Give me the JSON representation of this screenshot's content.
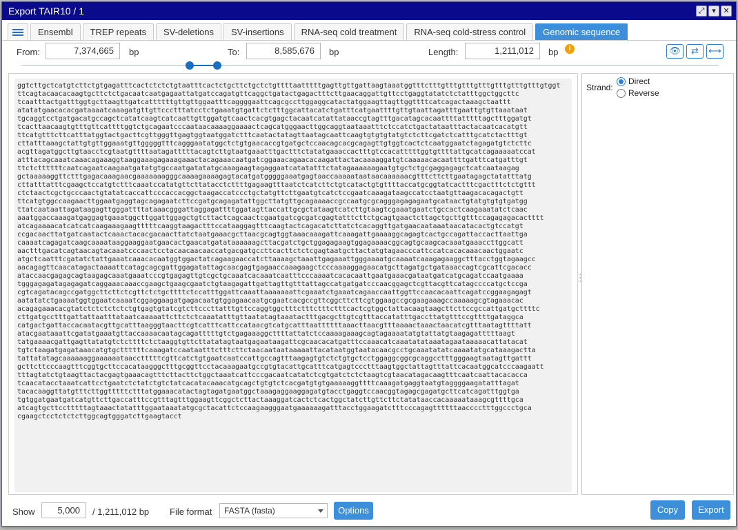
{
  "window": {
    "title": "Export TAIR10 / 1",
    "buttons": {
      "maximize": "⤢",
      "minimize": "▾",
      "close": "✕"
    }
  },
  "tabs": [
    {
      "label": "Ensembl"
    },
    {
      "label": "TREP repeats"
    },
    {
      "label": "SV-deletions"
    },
    {
      "label": "SV-insertions"
    },
    {
      "label": "RNA-seq cold treatment"
    },
    {
      "label": "RNA-seq cold-stress control"
    },
    {
      "label": "Genomic sequence",
      "active": true
    }
  ],
  "range": {
    "from_label": "From:",
    "from_value": "7,374,665",
    "from_unit": "bp",
    "to_label": "To:",
    "to_value": "8,585,676",
    "to_unit": "bp",
    "length_label": "Length:",
    "length_value": "1,211,012",
    "length_unit": "bp",
    "info_icon": "i"
  },
  "tools": {
    "view": "👁",
    "swap": "⇄",
    "fit": "⟷"
  },
  "strand": {
    "label": "Strand:",
    "options": [
      {
        "label": "Direct",
        "checked": true
      },
      {
        "label": "Reverse",
        "checked": false
      }
    ]
  },
  "sequence": {
    "lines": [
      "ggtcttgctcatgtcttctgtgagatttcactctctctgtaatttcactctgcttctgctctgttttaatttttgagttgttgattaagtaaatggtttctttgtttgtttgtttgtttgtttgtttgtggt",
      "ttcagtacaacacaagtgcttctctgacaatcaatgagaattatgatccagatgttcaggctgatactgagactttcttgaacaggattgttcctgaggtatatctctatttggctggcttc",
      "tcaatttactgatttggtgcttaagttgatcattttttgttgttggaatttcaggggaattcagcgccttggaggcatactatggaagttagttggttttcatcagactaaagctaattt",
      "atatatgaacacacgataaaatcaaagatgttgttccctttatcctctgaaatgtgattctctttggcattacatctgatttcatgaattttgttgtaattagatttgaattgtgttaaataat",
      "tgcaggtcctgatgacatgccagctcatatcaagtcatcaattgttggatgtcaactcacgtgagctacaatcatattataaccgtagtttgacatagcacaattttatttttagctttggatgt",
      "tcacttaacaagtgtttgttcattttggtctgcagaatcccaataacaaaaggaaaactcagcatgggaacttggcaggtaataaatttctccatctgactataatttactacaatcacatgtt",
      "ttcatgtttcttcatttatggtactgacttcgttgggttgagtggtaatggatctttcaatactatagttaatagcaattcaagtgtgtgtatgtctcttcgatctcatttgcatctactttgt",
      "cttatttaaagctattgtgttggaaatgttgggggtttcagggaatatggctctgtgaacaccgtgatgctccaacagcacgcagagttgtggtcactctcaatggaatctagagatgtctcttc",
      "acgttagatggcttgtaacctcgtaatgttttaatagatttttacagtcttgtaatgaaatttgactttctatatgaaaccactttgtccacatttttggtgttttattgcatcagaaaaatccat",
      "atttacagcaaatcaaacagaaaggtaaggaaagagaaagaaactacagaaacaatgatcggaaacagaacacaagattactacaaaaggatgtcaaaaacacaattttgatttcatgatttgt",
      "ttctcttttttcaatcagaatcaagaatgatatgtgccaatgatatatgcaaagaagtagaggaatcatatatttctatagaaaaaagaatgtgctctgcgaggagagctcatcaataagag",
      "gctaaaaaggttctttgagacaaagaacgaaaaaaagggcaaaagaaaagagtacatgatgggggaaatgagtaaccaaaaataataacaaaaaacgtttcttcttgaatagagctatatttatg",
      "cttatttatttcgaagctccatgtctttcaaatccatatgttcttatacctcttttgagaagtttaatctcatcttctgtcatactgtgttttaccatgcggtatcactttcgactttctctgttt",
      "ctctaactcgctgcccaactgtatatcaccattcccaccacggctaagaccatccctgctatgttcttgaatgtcatctccgaatcaaagataagccatcctaatgttaagacacagactgtt",
      "ttcatgtggccaagaacttggaatgaggtagcagagaatcttccgatgcagagatattggcttatgttgcagaaaaccgccaatgcgcagggagagagaatgcataactgtatgtgtgtgatgg",
      "ttatcaataattagataagagttgggattttataaacgggattaggagattttggatagttaccattgcgctataagtcatcttgtaagtcgaaatgaatctgccactcaagaaatatctcaac",
      "aaatggaccaaagatgaggagtgaaatggcttggattggagctgtcttactcagcaactcgaatgatcgcgatcgagtatttcttctgcagtgaactcttagctgcttgtttccagagagacactttt",
      "atcagaaaacatcatcatcaagaaagaagtttttcaaggtaagactttccataaggagtttcaagtactcagacatcttatctcacaggttgatgaacaataaataacatacactgtccatgt",
      "ccgacaacttatgatcaatactcaaactacacgacaacttatctaatgaaacgcttaacgcagtggtaaacaaagattcaaagattgaaaaggcagagtcactgccagattaccacttaattga",
      "caaaatcagagatcaagcaaaataaggaaggaatgaacactgaacatgatataaaaaagcttacgatctgctggagagaagtggagaaaacggcagtgcaagcacaaatgaaaccttggcatt",
      "aactttgacatcagtaacagtacaaatcccaactcctacaacaacaaccatgacgatgccttcacttctctcgagtaatgcttactatgtagaacccattccatcacacaaacaactggaatc",
      "atgctcaatttcgatatctattgaaatcaaacacaatggtggactatcagaagaaccatcttaaaagctaaattgagaaattgggaaaatgcaaaatcaaagagaaggctttacctggtagaagcc",
      "aacagagttcaacatagactaaaattcatagcagcgattggagatattagcaacgagtgagaaccaaagaagctcccaaaaggagaacatgcttagatgctgataaaccagtcgcattcgacacc",
      "ataccaacgagagcagtaagagcaaatgaaatcccgtgagagttgtcgctgcaaatcacaaatcaatttcccaaaatcacacaattgaatgaaacgataatgatcatgcagatccaatgaaaa",
      "tgggagagatagagagatcaggaaacaaaccgaagctgaagcgaatctgtaagagattgattagttgtttattagccatgatgatcccaacggagctcgttacgttcatagccccatgctccga",
      "cgtcagatacagccgatggcttcttctcgttctctgcttttctccatttggattcaaattaaaaaaattcgaaatctgaaatcagaaccaattggttccaacacaattcagatccggaagagagt",
      "aatatatctgaaaatggtggaatcaaaatcggaggaagatgagacaatgtggagaacaatgcgaatcacgccgttcggcttcttcgtggaagccgcgaagaaagccaaaaagcgtagaaacac",
      "acagagaaacacgtatctctctctctctgtgagtgtatcgtcttcccttatttgttccaggtggctttctttctttctttcactcgtggctattacaagtaagcttcttccgccattgatgcttttc",
      "cttgatgcctttgattattaatttataatcaaaaattcttctctcaaatatttgttaatatagtaaatactttgacgcttgtcgtttaccatatttgaccttatgtttccgttttgataggca",
      "catgactgattaccacaatacgttgcatttaagggtaacttcgtcatttcattccataacgtcatgcatttaattttttaaacttaacgtttaaaactaaactaacatcgtttaatagttttatt",
      "atacgaataaattcgatatgaaatgttaccaaaacaatagcagatttttgtctgagaaaggcttttattatctccaaaagaaagcagtagaaaatatgtattatgtaagagatttttaagt",
      "tatgaaaacgattgagttatatgtctcttttctctaaggtgttcttatatagtaatgagaataagattcgcaacacatgatttccaaacatcaaatatataaatagaataaaaacattatacat",
      "tgtctaagatgagataaacatgtgcttttttcaaagatccaataatttctttcttctaacaataataaaaattacataatggtaatacaacgcctgcaaatatatcaaaatatgcataaagactta",
      "tattatatagcaaaaaaggaaaaaataacctttttcgttcatctgtgaatcaatccattgccagtttaagagtgtctctgtgctcctggaggcggcgcaggcctttgggaagtaatagttgattt",
      "gcttcttcccaagtttcggtgcttccacataagggctttgcggttcctacaaagaatgccgtgtacattgcatttcatgagtccctttaagtggctattagtttattcacaatggcatcccaagaatt",
      "tttagtatctgtaagttactacgagtgaaacagtttcttacttctggctaaatcattcccgacaatcatatctcgtgatctctctaagtcgtaacatagacaagtttcaatcaattacacacca",
      "tcaacatacctaaatcattcctgaatctctatctgtctatcacatacaaacatgcagctgtgtctcacgatgtgtgaaaaaggttttcaaagatgaggtaatgtaggggaagatatttagat",
      "tacacaaggttatgtttcttggtttttctttatggaaacatactagtagatgaatggctaaagaggaaggagatgtacctgaggtccaacggtagagcgagatgcttcatcagatttggtga",
      "tgtggatgaatgatcatgttcttgaccatttccgtttagtttggaagttcggctcttactaaaggatcactctcactggctatcttgttcttctatataaccacaaaaataaagcgttttgca",
      "atcagtgcttcctttttagtaaactatatttggaataaatatgcgctacattctccaagaagggaatgaaaaaagatttacctggaagatctttcccagagttttttaacccctttggccctgca",
      "cgaagctcctctctcttggcagtgggatcttgaagtacct"
    ]
  },
  "footer": {
    "show_label": "Show",
    "show_value": "5,000",
    "total": "/ 1,211,012 bp",
    "format_label": "File format",
    "format_value": "FASTA (fasta)",
    "options_label": "Options",
    "copy_label": "Copy",
    "export_label": "Export"
  }
}
